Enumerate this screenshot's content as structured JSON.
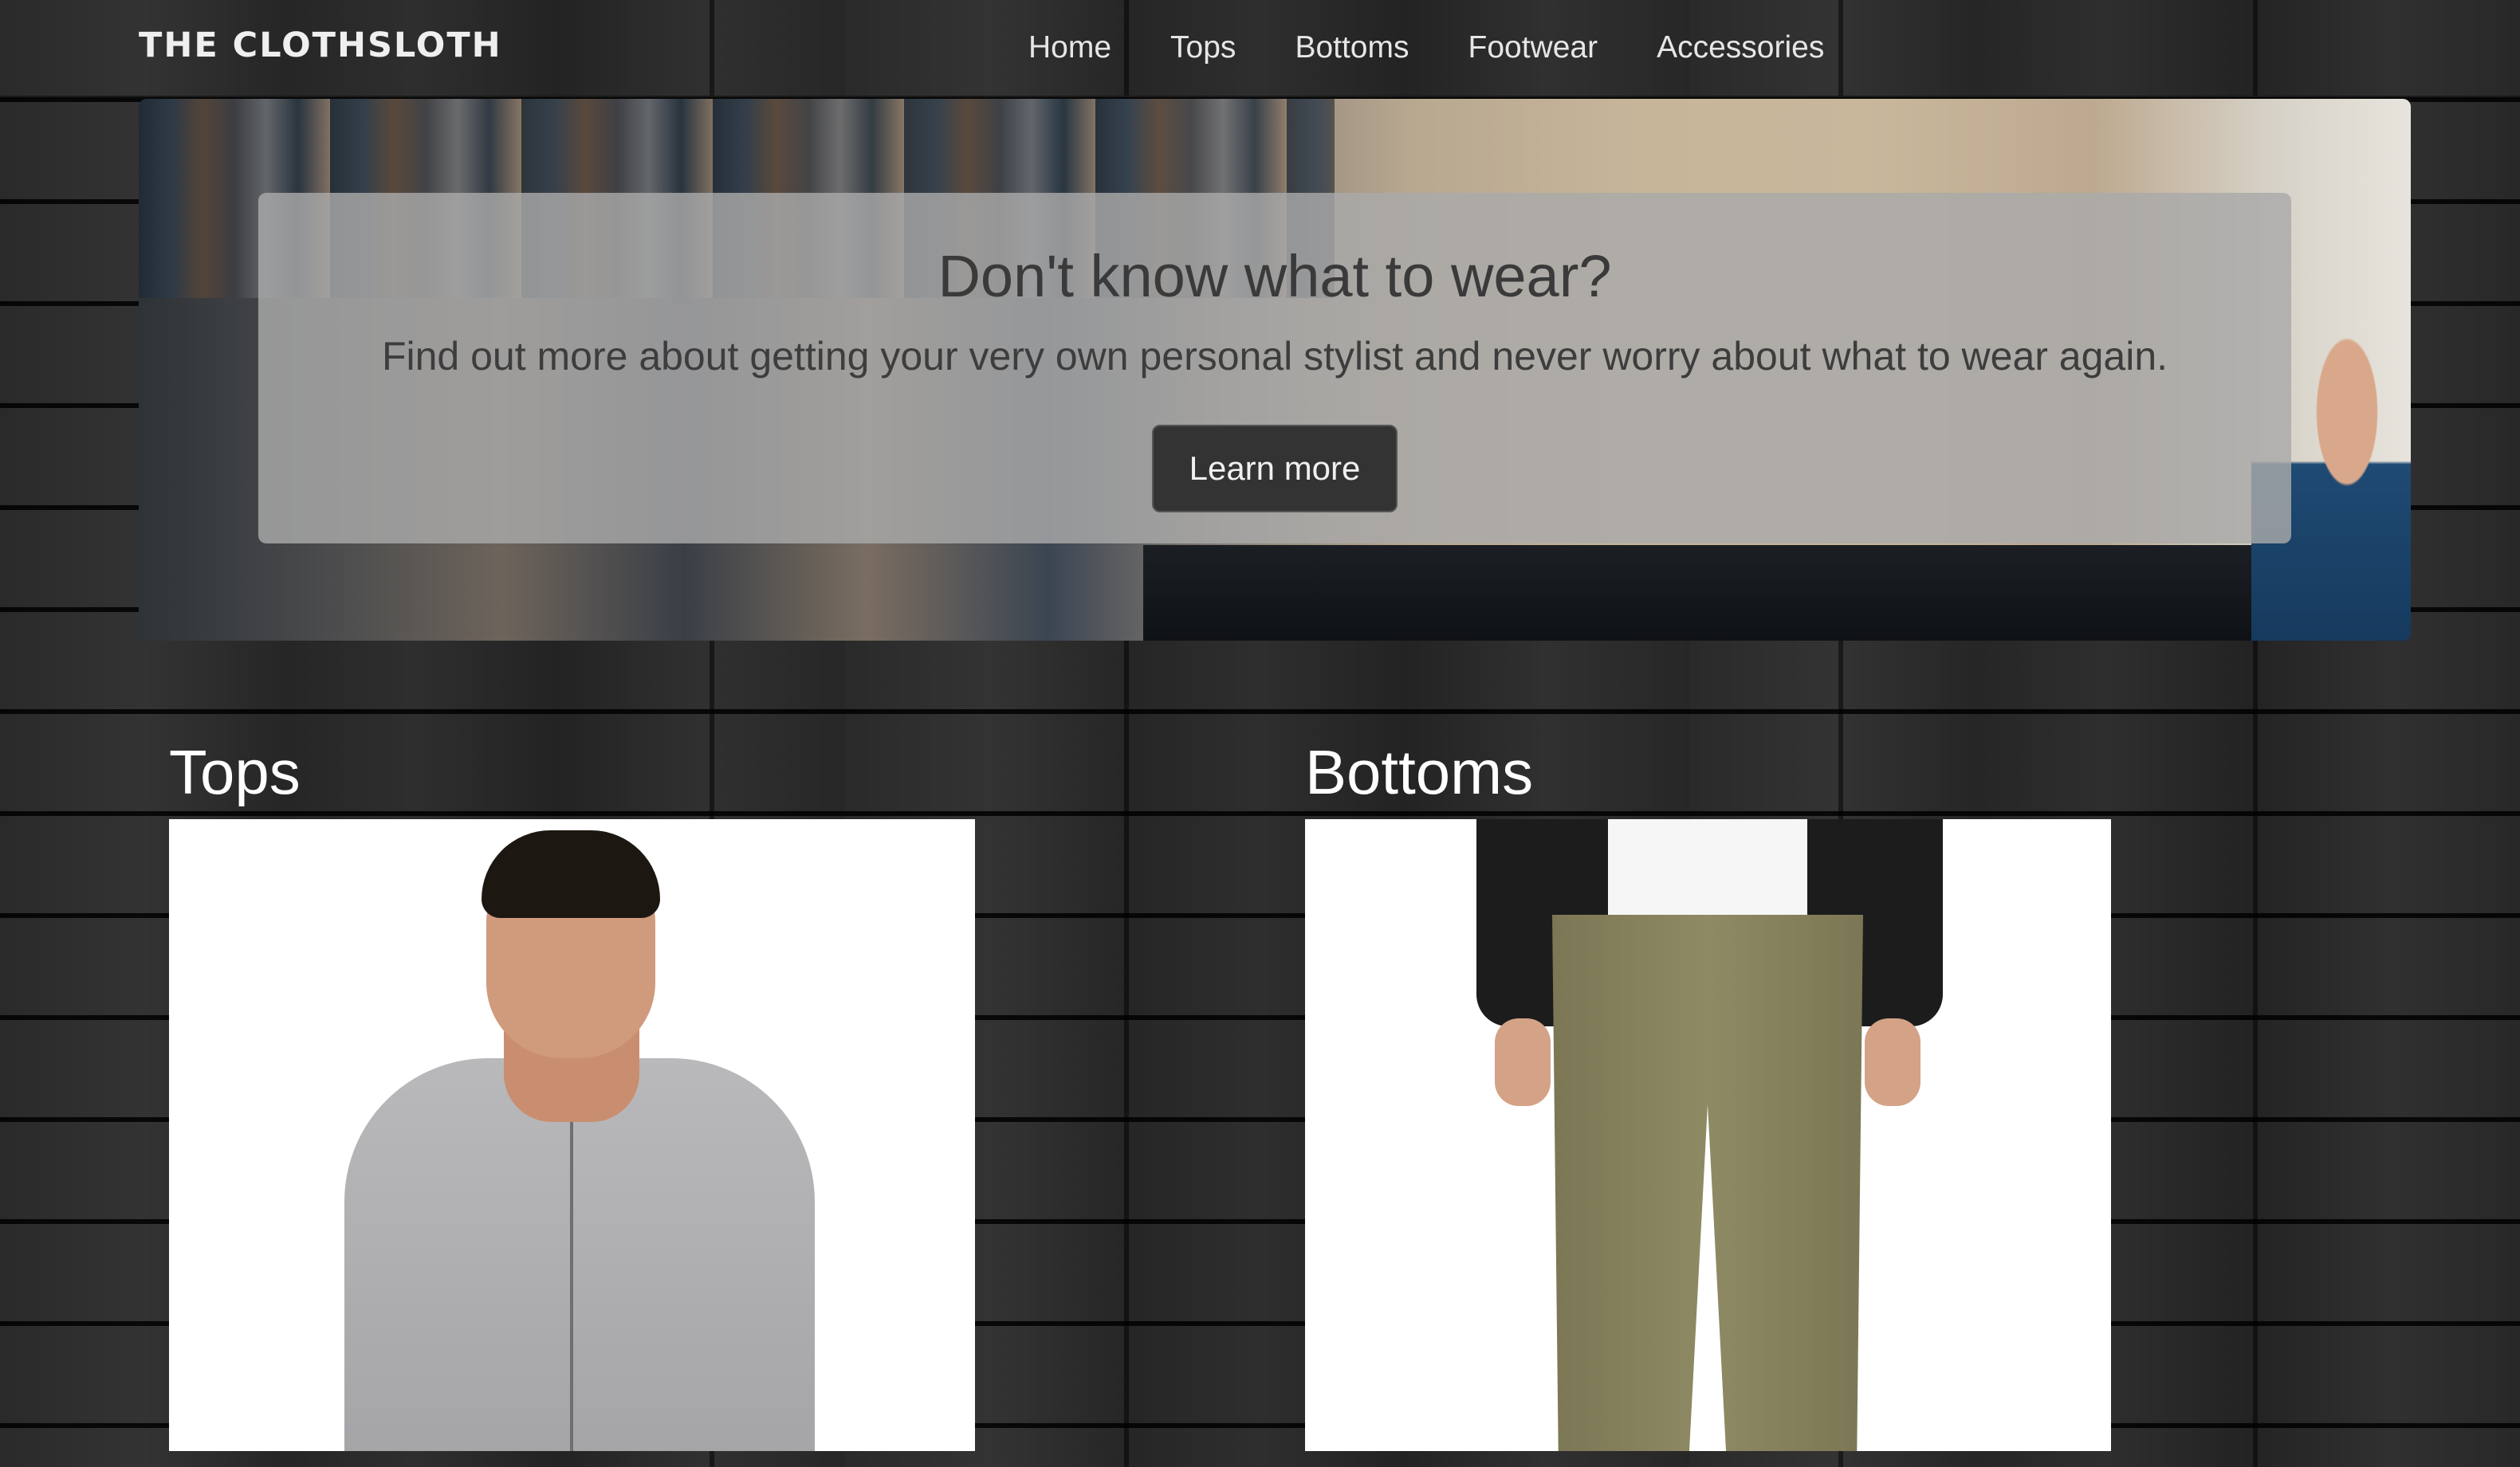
{
  "brand": {
    "name": "THE CLOTHSLOTH"
  },
  "nav": {
    "items": [
      {
        "label": "Home"
      },
      {
        "label": "Tops"
      },
      {
        "label": "Bottoms"
      },
      {
        "label": "Footwear"
      },
      {
        "label": "Accessories"
      }
    ]
  },
  "hero": {
    "title": "Don't know what to wear?",
    "text": "Find out more about getting your very own personal stylist and never worry about what to wear again.",
    "button_label": "Learn more"
  },
  "categories": [
    {
      "title": "Tops"
    },
    {
      "title": "Bottoms"
    }
  ],
  "colors": {
    "page_background": "#282828",
    "overlay": "#aaaaaa",
    "button": "#333333",
    "text_light": "#ffffff"
  }
}
